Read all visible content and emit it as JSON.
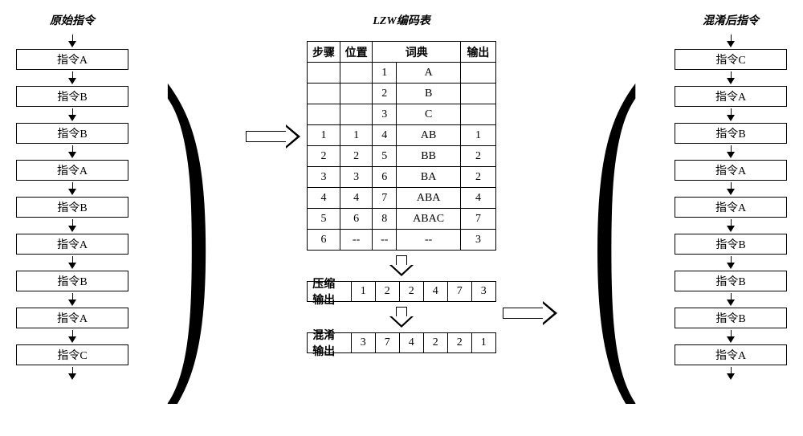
{
  "titles": {
    "left": "原始指令",
    "center": "LZW编码表",
    "right": "混淆后指令"
  },
  "left_flow": [
    "指令A",
    "指令B",
    "指令B",
    "指令A",
    "指令B",
    "指令A",
    "指令B",
    "指令A",
    "指令C"
  ],
  "right_flow": [
    "指令C",
    "指令A",
    "指令B",
    "指令A",
    "指令A",
    "指令B",
    "指令B",
    "指令B",
    "指令A"
  ],
  "table": {
    "headers": {
      "step": "步骤",
      "pos": "位置",
      "dict": "词典",
      "out": "输出"
    },
    "rows": [
      {
        "step": "",
        "pos": "",
        "d1": "1",
        "d2": "A",
        "out": ""
      },
      {
        "step": "",
        "pos": "",
        "d1": "2",
        "d2": "B",
        "out": ""
      },
      {
        "step": "",
        "pos": "",
        "d1": "3",
        "d2": "C",
        "out": ""
      },
      {
        "step": "1",
        "pos": "1",
        "d1": "4",
        "d2": "AB",
        "out": "1"
      },
      {
        "step": "2",
        "pos": "2",
        "d1": "5",
        "d2": "BB",
        "out": "2"
      },
      {
        "step": "3",
        "pos": "3",
        "d1": "6",
        "d2": "BA",
        "out": "2"
      },
      {
        "step": "4",
        "pos": "4",
        "d1": "7",
        "d2": "ABA",
        "out": "4"
      },
      {
        "step": "5",
        "pos": "6",
        "d1": "8",
        "d2": "ABAC",
        "out": "7"
      },
      {
        "step": "6",
        "pos": "--",
        "d1": "--",
        "d2": "--",
        "out": "3"
      }
    ]
  },
  "compress": {
    "label": "压缩输出",
    "values": [
      "1",
      "2",
      "2",
      "4",
      "7",
      "3"
    ]
  },
  "obfuscate": {
    "label": "混淆输出",
    "values": [
      "3",
      "7",
      "4",
      "2",
      "2",
      "1"
    ]
  },
  "chart_data": {
    "type": "table",
    "description": "LZW encoding process diagram showing original instruction sequence, LZW dictionary encoding table, compressed output, reversed/obfuscated output, and resulting instruction sequence",
    "original_sequence": [
      "A",
      "B",
      "B",
      "A",
      "B",
      "A",
      "B",
      "A",
      "C"
    ],
    "lzw_dictionary": [
      {
        "index": 1,
        "entry": "A"
      },
      {
        "index": 2,
        "entry": "B"
      },
      {
        "index": 3,
        "entry": "C"
      },
      {
        "index": 4,
        "entry": "AB"
      },
      {
        "index": 5,
        "entry": "BB"
      },
      {
        "index": 6,
        "entry": "BA"
      },
      {
        "index": 7,
        "entry": "ABA"
      },
      {
        "index": 8,
        "entry": "ABAC"
      }
    ],
    "encoding_steps": [
      {
        "step": 1,
        "position": 1,
        "dict_index": 4,
        "dict_entry": "AB",
        "output": 1
      },
      {
        "step": 2,
        "position": 2,
        "dict_index": 5,
        "dict_entry": "BB",
        "output": 2
      },
      {
        "step": 3,
        "position": 3,
        "dict_index": 6,
        "dict_entry": "BA",
        "output": 2
      },
      {
        "step": 4,
        "position": 4,
        "dict_index": 7,
        "dict_entry": "ABA",
        "output": 4
      },
      {
        "step": 5,
        "position": 6,
        "dict_index": 8,
        "dict_entry": "ABAC",
        "output": 7
      },
      {
        "step": 6,
        "position": null,
        "dict_index": null,
        "dict_entry": null,
        "output": 3
      }
    ],
    "compressed_output": [
      1,
      2,
      2,
      4,
      7,
      3
    ],
    "obfuscated_output": [
      3,
      7,
      4,
      2,
      2,
      1
    ],
    "obfuscated_sequence": [
      "C",
      "A",
      "B",
      "A",
      "A",
      "B",
      "B",
      "B",
      "A"
    ]
  }
}
